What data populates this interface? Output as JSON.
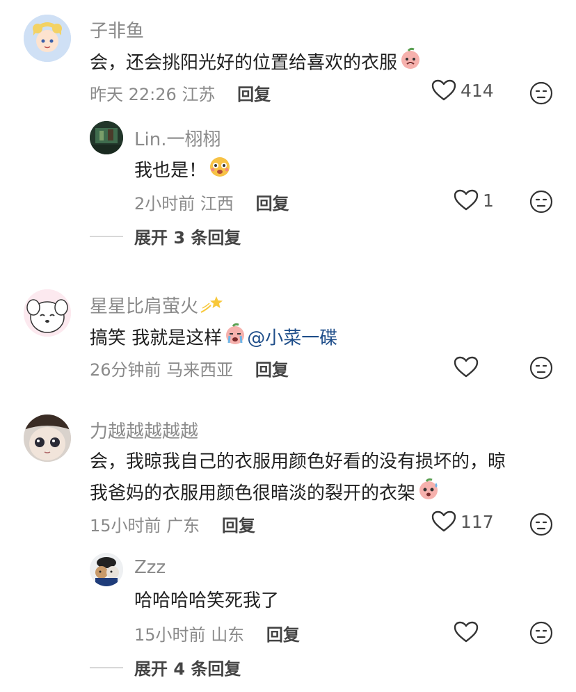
{
  "comments": [
    {
      "username": "子非鱼",
      "text": "会，还会挑阳光好的位置给喜欢的衣服",
      "time": "昨天 22:26",
      "location": "江苏",
      "reply_label": "回复",
      "likes": "414",
      "replies": [
        {
          "username": "Lin.一栩栩",
          "text": "我也是！",
          "time": "2小时前",
          "location": "江西",
          "reply_label": "回复",
          "likes": "1"
        }
      ],
      "expand_label": "展开 3 条回复"
    },
    {
      "username": "星星比肩萤火",
      "text": "搞笑 我就是这样",
      "mention": "@小菜一碟",
      "time": "26分钟前",
      "location": "马来西亚",
      "reply_label": "回复",
      "likes": ""
    },
    {
      "username": "力越越越越越",
      "text_line1": "会，我晾我自己的衣服用颜色好看的没有损坏的，晾",
      "text_line2": "我爸妈的衣服用颜色很暗淡的裂开的衣架",
      "time": "15小时前",
      "location": "广东",
      "reply_label": "回复",
      "likes": "117",
      "replies": [
        {
          "username": "Zzz",
          "text": "哈哈哈哈笑死我了",
          "time": "15小时前",
          "location": "山东",
          "reply_label": "回复",
          "likes": ""
        }
      ],
      "expand_label": "展开 4 条回复"
    }
  ],
  "icons": {
    "like": "heart-outline-icon",
    "dislike": "unamused-face-icon"
  },
  "colors": {
    "username": "#8a8a8a",
    "mention": "#1f4e8a",
    "avatar_1": "#cfe0f5",
    "avatar_2": "#2f4f3a",
    "avatar_3": "#fce9ef",
    "avatar_4": "#d9d2cc",
    "avatar_5": "#eef0f2"
  }
}
